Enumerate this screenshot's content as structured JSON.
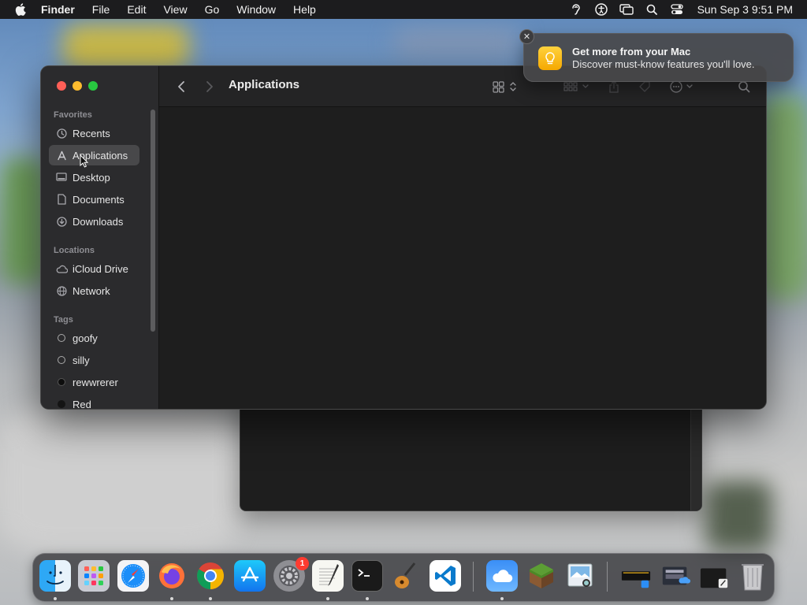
{
  "menubar": {
    "apple_icon": "apple-logo-icon",
    "app_name": "Finder",
    "items": [
      "File",
      "Edit",
      "View",
      "Go",
      "Window",
      "Help"
    ],
    "status_icons": [
      "hearing-icon",
      "accessibility-icon",
      "screen-mirroring-icon",
      "spotlight-search-icon",
      "control-center-icon"
    ],
    "clock": "Sun Sep 3  9:51 PM"
  },
  "finder": {
    "title": "Applications",
    "sidebar": {
      "favorites_header": "Favorites",
      "favorites": [
        {
          "label": "Recents",
          "icon": "clock-icon"
        },
        {
          "label": "Applications",
          "icon": "applications-icon",
          "selected": true
        },
        {
          "label": "Desktop",
          "icon": "desktop-icon"
        },
        {
          "label": "Documents",
          "icon": "document-icon"
        },
        {
          "label": "Downloads",
          "icon": "download-icon"
        }
      ],
      "locations_header": "Locations",
      "locations": [
        {
          "label": "iCloud Drive",
          "icon": "cloud-icon"
        },
        {
          "label": "Network",
          "icon": "globe-icon"
        }
      ],
      "tags_header": "Tags",
      "tags": [
        {
          "label": "goofy",
          "style": "hollow"
        },
        {
          "label": "silly",
          "style": "hollow"
        },
        {
          "label": "rewwrerer",
          "style": "filled"
        },
        {
          "label": "Red",
          "style": "filled"
        }
      ]
    },
    "toolbar_icons": [
      "back-icon",
      "forward-icon",
      "view-grid-icon",
      "group-icon",
      "share-icon",
      "tag-icon",
      "action-icon",
      "search-icon"
    ]
  },
  "notification": {
    "title": "Get more from your Mac",
    "body": "Discover must-know features you'll love.",
    "icon": "tips-lightbulb-icon"
  },
  "dock": {
    "apps": [
      "finder",
      "launchpad",
      "safari",
      "firefox",
      "chrome",
      "app-store",
      "system-settings",
      "textedit",
      "terminal",
      "garageband",
      "vscode",
      "weather",
      "minecraft",
      "preview",
      "downloads-stack",
      "screenshots-stack",
      "documents-stack",
      "trash"
    ],
    "system_settings_badge": "1"
  }
}
